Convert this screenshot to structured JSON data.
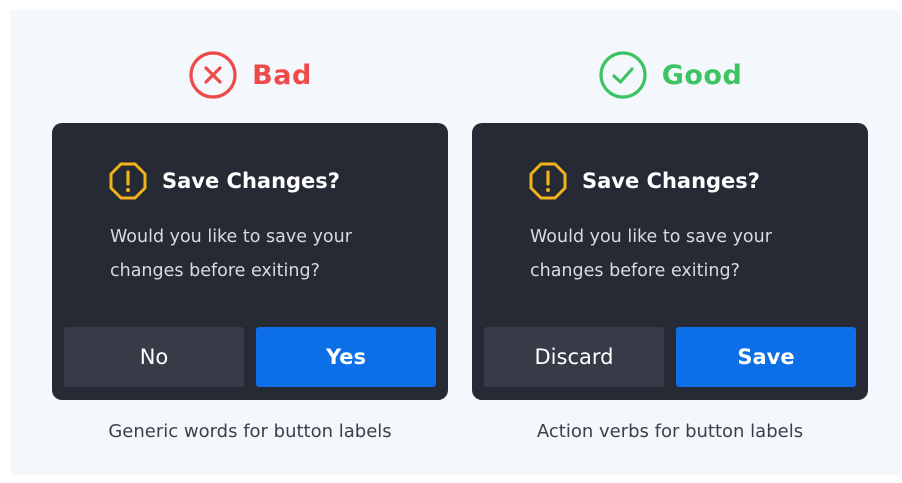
{
  "colors": {
    "bad": "#ee4a4a",
    "good": "#3cc463",
    "warning": "#f2b21b",
    "dialog_bg": "#252a35",
    "primary_button": "#0c6fe8",
    "secondary_button": "#363b47",
    "page_bg": "#f4f7fb"
  },
  "bad_example": {
    "verdict_icon": "x-circle-icon",
    "verdict_label": "Bad",
    "dialog": {
      "icon": "warning-octagon-icon",
      "title": "Save Changes?",
      "body_line_1": "Would you like to save your",
      "body_line_2": "changes before exiting?",
      "secondary_button": "No",
      "primary_button": "Yes"
    },
    "caption": "Generic words for button labels"
  },
  "good_example": {
    "verdict_icon": "check-circle-icon",
    "verdict_label": "Good",
    "dialog": {
      "icon": "warning-octagon-icon",
      "title": "Save Changes?",
      "body_line_1": "Would you like to save your",
      "body_line_2": "changes before exiting?",
      "secondary_button": "Discard",
      "primary_button": "Save"
    },
    "caption": "Action verbs for button labels"
  }
}
